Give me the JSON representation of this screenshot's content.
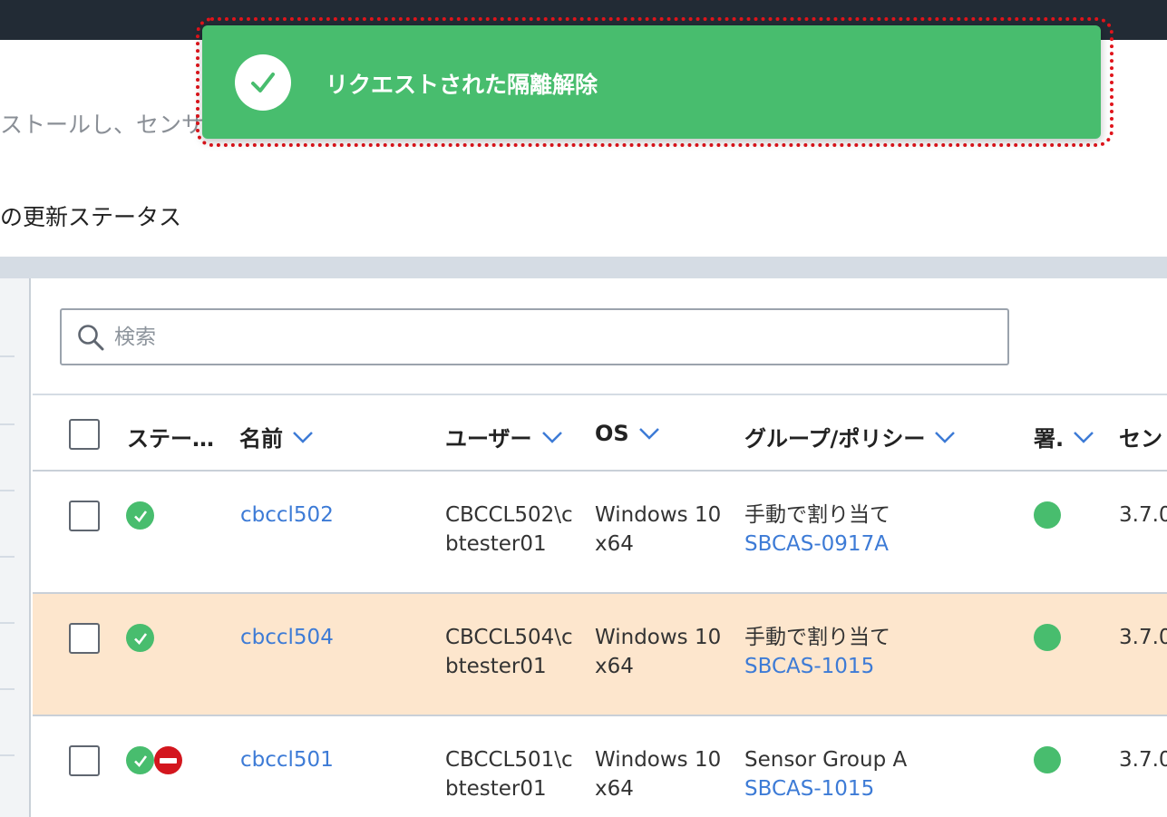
{
  "toast": {
    "message": "リクエストされた隔離解除",
    "icon": "check-circle-icon",
    "color": "#48bd6e"
  },
  "page": {
    "intro_text": "ストールし、センサ",
    "update_status_label": "の更新ステータス"
  },
  "search": {
    "placeholder": "検索",
    "value": ""
  },
  "table": {
    "columns": {
      "status": "ステー…",
      "name": "名前",
      "user": "ユーザー",
      "os": "OS",
      "group_policy": "グループ/ポリシー",
      "signature": "署.",
      "sensor": "セン"
    },
    "rows": [
      {
        "name": "cbccl502",
        "user_line1": "CBCCL502\\c",
        "user_line2": "btester01",
        "os_line1": "Windows 10",
        "os_line2": "x64",
        "group": "手動で割り当て",
        "policy": "SBCAS-0917A",
        "sensor_version": "3.7.0",
        "status": [
          "online"
        ],
        "highlighted": false
      },
      {
        "name": "cbccl504",
        "user_line1": "CBCCL504\\c",
        "user_line2": "btester01",
        "os_line1": "Windows 10",
        "os_line2": "x64",
        "group": "手動で割り当て",
        "policy": "SBCAS-1015",
        "sensor_version": "3.7.0",
        "status": [
          "online"
        ],
        "highlighted": true
      },
      {
        "name": "cbccl501",
        "user_line1": "CBCCL501\\c",
        "user_line2": "btester01",
        "os_line1": "Windows 10",
        "os_line2": "x64",
        "group": "Sensor Group A",
        "policy": "SBCAS-1015",
        "sensor_version": "3.7.0",
        "status": [
          "online",
          "quarantined"
        ],
        "highlighted": false
      }
    ]
  },
  "colors": {
    "topbar": "#222b35",
    "link": "#3d7bd6",
    "ok_green": "#48bd6e",
    "quarantine_red": "#d3161e",
    "row_highlight": "#fde6cd"
  }
}
